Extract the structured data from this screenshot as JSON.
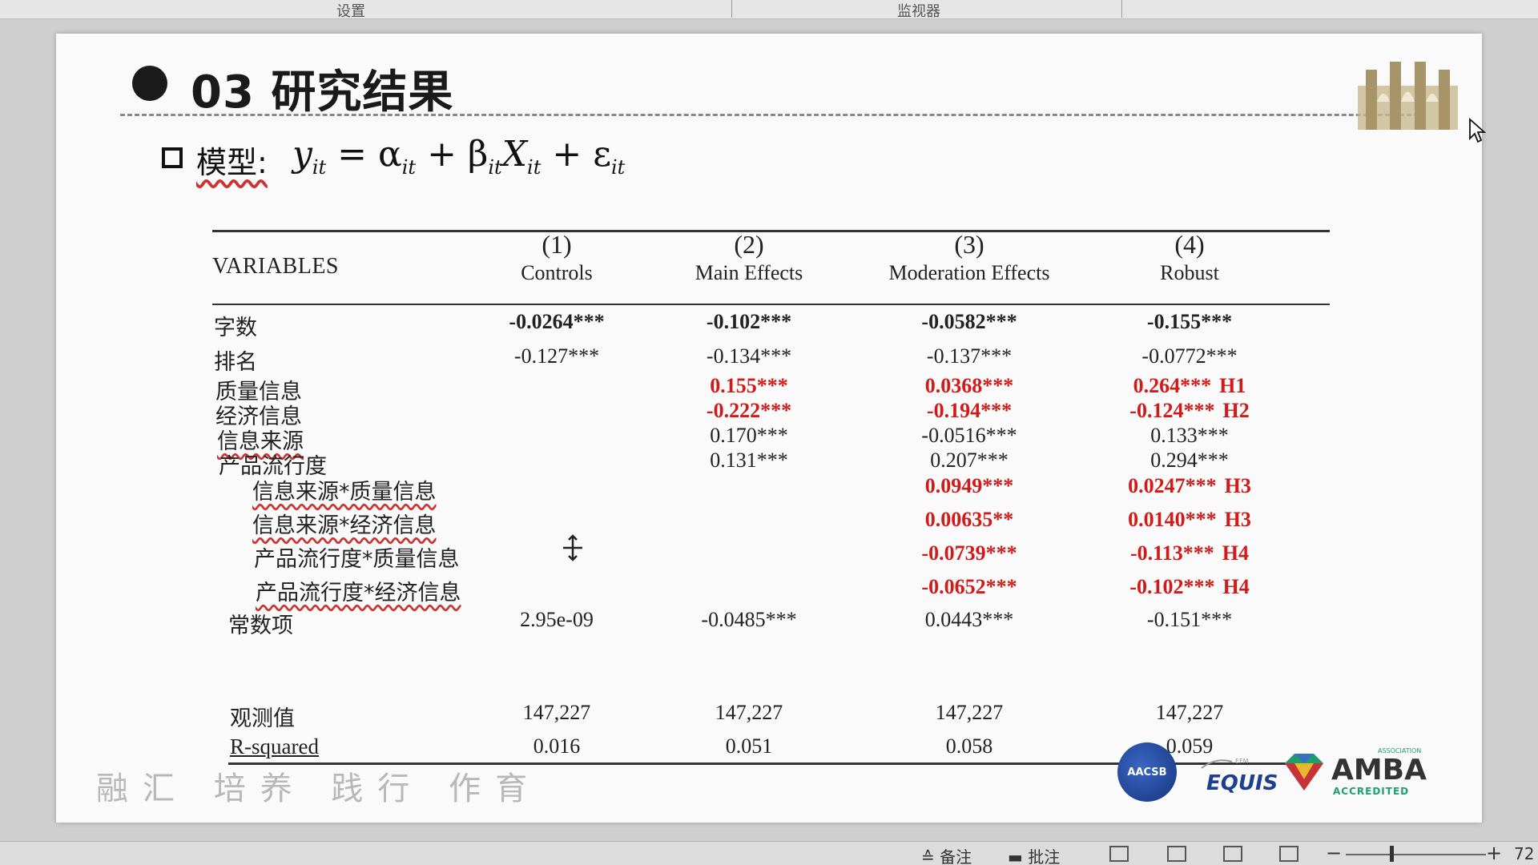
{
  "top_bar": {
    "tab_left": "设置",
    "tab_right": "监视器"
  },
  "slide": {
    "title": "03 研究结果",
    "model_label": "模型:",
    "model_formula": {
      "y": "y",
      "it": "it",
      "eq": " = ",
      "alpha": "α",
      "plus1": " + ",
      "beta": "β",
      "X": "X",
      "plus2": " + ",
      "eps": "ε"
    },
    "slogan": "融汇 培养 践行 作育"
  },
  "table": {
    "variables_header": "VARIABLES",
    "columns": [
      {
        "num": "(1)",
        "name": "Controls"
      },
      {
        "num": "(2)",
        "name": "Main Effects"
      },
      {
        "num": "(3)",
        "name": "Moderation Effects"
      },
      {
        "num": "(4)",
        "name": "Robust"
      }
    ],
    "rows": [
      {
        "label": "字数",
        "c1": "-0.0264***",
        "c2": "-0.102***",
        "c3": "-0.0582***",
        "c4": "-0.155***",
        "h4": ""
      },
      {
        "label": "排名",
        "c1": "-0.127***",
        "c2": "-0.134***",
        "c3": "-0.137***",
        "c4": "-0.0772***",
        "h4": ""
      },
      {
        "label": "质量信息",
        "c1": "",
        "c2": "0.155***",
        "c3": "0.0368***",
        "c4": "0.264***",
        "h4": "H1"
      },
      {
        "label": "经济信息",
        "c1": "",
        "c2": "-0.222***",
        "c3": "-0.194***",
        "c4": "-0.124***",
        "h4": "H2"
      },
      {
        "label": "信息来源",
        "c1": "",
        "c2": "0.170***",
        "c3": "-0.0516***",
        "c4": "0.133***",
        "h4": ""
      },
      {
        "label": "产品流行度",
        "c1": "",
        "c2": "0.131***",
        "c3": "0.207***",
        "c4": "0.294***",
        "h4": ""
      },
      {
        "label": "信息来源*质量信息",
        "c1": "",
        "c2": "",
        "c3": "0.0949***",
        "c4": "0.0247***",
        "h4": "H3"
      },
      {
        "label": "信息来源*经济信息",
        "c1": "",
        "c2": "",
        "c3": "0.00635**",
        "c4": "0.0140***",
        "h4": "H3"
      },
      {
        "label": "产品流行度*质量信息",
        "c1": "",
        "c2": "",
        "c3": "-0.0739***",
        "c4": "-0.113***",
        "h4": "H4"
      },
      {
        "label": "产品流行度*经济信息",
        "c1": "",
        "c2": "",
        "c3": "-0.0652***",
        "c4": "-0.102***",
        "h4": "H4"
      },
      {
        "label": "常数项",
        "c1": "2.95e-09",
        "c2": "-0.0485***",
        "c3": "0.0443***",
        "c4": "-0.151***",
        "h4": ""
      },
      {
        "label": "观测值",
        "c1": "147,227",
        "c2": "147,227",
        "c3": "147,227",
        "c4": "147,227",
        "h4": ""
      },
      {
        "label": "R-squared",
        "c1": "0.016",
        "c2": "0.051",
        "c3": "0.058",
        "c4": "0.059",
        "h4": ""
      }
    ]
  },
  "logos": {
    "aacsb": "AACSB",
    "equis": "EQUIS",
    "equis_top": "EFMD",
    "amba": "AMBA",
    "amba_sub": "ACCREDITED",
    "amba_top": "ASSOCIATION"
  },
  "status_bar": {
    "notes": "备注",
    "comments": "批注",
    "zoom_minus": "−",
    "zoom_plus": "+",
    "zoom_value": "72"
  },
  "colors": {
    "highlight_red": "#d11a1a",
    "rule": "#333333",
    "aacsb_blue": "#14357d",
    "amba_green": "#1ea06e"
  }
}
